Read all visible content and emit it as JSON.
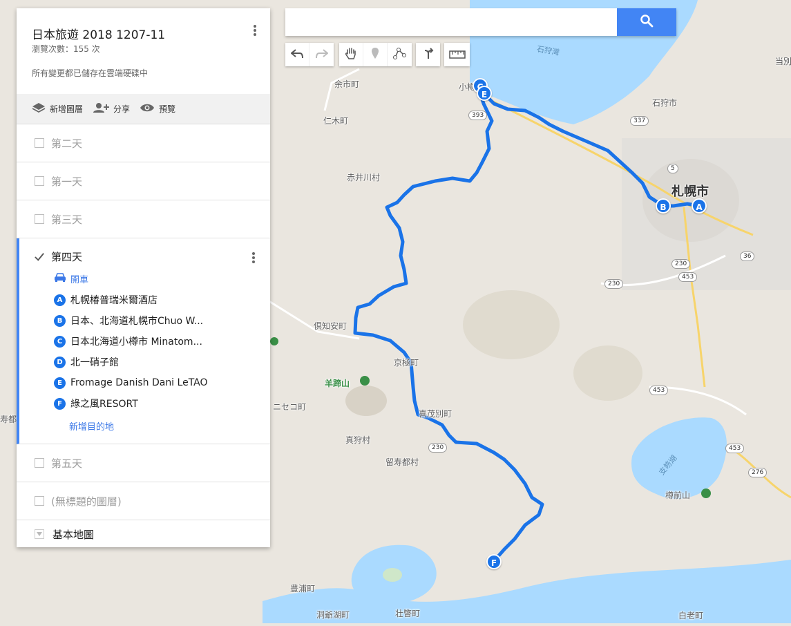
{
  "map_title": "日本旅遊 2018 1207-11",
  "views": "瀏覽次數：155 次",
  "save_status": "所有變更都已儲存在雲端硬碟中",
  "actions": {
    "add_layer": "新增圖層",
    "share": "分享",
    "preview": "預覽"
  },
  "layers": [
    {
      "name": "第二天",
      "checked": false
    },
    {
      "name": "第一天",
      "checked": false
    },
    {
      "name": "第三天",
      "checked": false
    },
    {
      "name": "第四天",
      "checked": true
    },
    {
      "name": "第五天",
      "checked": false
    },
    {
      "name": "(無標題的圖層)",
      "checked": false
    }
  ],
  "day4": {
    "mode": "開車",
    "stops": [
      {
        "letter": "A",
        "name": "札幌椿普瑞米爾酒店"
      },
      {
        "letter": "B",
        "name": "日本、北海道札幌市Chuo W..."
      },
      {
        "letter": "C",
        "name": "日本北海道小樽市 Minatom..."
      },
      {
        "letter": "D",
        "name": "北一硝子館"
      },
      {
        "letter": "E",
        "name": "Fromage Danish Dani LeTAO"
      },
      {
        "letter": "F",
        "name": "綠之風RESORT"
      }
    ],
    "add_destination": "新增目的地"
  },
  "basemap": "基本地圖",
  "search": {
    "value": "",
    "placeholder": ""
  },
  "icons": {
    "undo": "undo-icon",
    "redo": "redo-icon",
    "pan": "hand-icon",
    "marker": "marker-icon",
    "line": "draw-line-icon",
    "directions": "directions-icon",
    "ruler": "ruler-icon"
  },
  "colors": {
    "route": "#1a73e8",
    "accent": "#4285f4",
    "water": "#aadaff",
    "land": "#eae6df"
  },
  "map_labels": {
    "sapporo": "札幌市",
    "ishikari": "石狩市",
    "ishikari_bay": "石狩灣",
    "otaru": "小樽市",
    "yoichi": "余市町",
    "niki": "仁木町",
    "akaigawa": "赤井川村",
    "kutchan": "倶知安町",
    "kyogoku": "京極町",
    "yotei": "羊蹄山",
    "niseko": "ニセコ町",
    "kimobetsu": "喜茂別町",
    "makkari": "真狩村",
    "rusutsu": "留寿都村",
    "shikotsu": "支笏湖",
    "tarumae": "樽前山",
    "toyoura": "豊浦町",
    "toyako": "洞爺湖町",
    "sobetsu": "壮瞥町",
    "shiraoi": "白老町",
    "suttsu": "寿都",
    "tobetsu": "当別"
  },
  "road_numbers": [
    "337",
    "5",
    "230",
    "453",
    "36",
    "393",
    "276"
  ],
  "route_markers": [
    "A",
    "B",
    "C",
    "E",
    "F"
  ]
}
